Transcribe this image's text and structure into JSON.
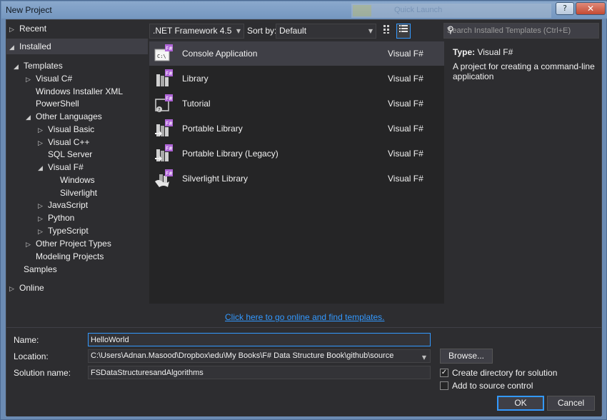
{
  "window": {
    "title": "New Project",
    "background_title": "Quick Launch"
  },
  "titlebar": {
    "help": "?",
    "close": "✕"
  },
  "tree": {
    "recent": "Recent",
    "installed": "Installed",
    "templates": "Templates",
    "visual_csharp": "Visual C#",
    "windows_installer_xml": "Windows Installer XML",
    "powershell": "PowerShell",
    "other_languages": "Other Languages",
    "visual_basic": "Visual Basic",
    "visual_cpp": "Visual C++",
    "sql_server": "SQL Server",
    "visual_fsharp": "Visual F#",
    "windows": "Windows",
    "silverlight": "Silverlight",
    "javascript": "JavaScript",
    "python": "Python",
    "typescript": "TypeScript",
    "other_project_types": "Other Project Types",
    "modeling_projects": "Modeling Projects",
    "samples": "Samples",
    "online": "Online"
  },
  "toolbar": {
    "framework": ".NET Framework 4.5",
    "sort_label": "Sort by:",
    "sort_value": "Default",
    "view_small_icons": "small-icons-view-icon",
    "view_list": "list-view-icon"
  },
  "templates": [
    {
      "name": "Console Application",
      "language": "Visual F#",
      "icon": "console-app-icon"
    },
    {
      "name": "Library",
      "language": "Visual F#",
      "icon": "library-icon"
    },
    {
      "name": "Tutorial",
      "language": "Visual F#",
      "icon": "tutorial-icon"
    },
    {
      "name": "Portable Library",
      "language": "Visual F#",
      "icon": "portable-library-icon"
    },
    {
      "name": "Portable Library (Legacy)",
      "language": "Visual F#",
      "icon": "portable-library-legacy-icon"
    },
    {
      "name": "Silverlight Library",
      "language": "Visual F#",
      "icon": "silverlight-library-icon"
    }
  ],
  "search": {
    "placeholder": "Search Installed Templates (Ctrl+E)"
  },
  "details": {
    "type_label": "Type:",
    "type_value": "Visual F#",
    "description": "A project for creating a command-line application"
  },
  "online_link": "Click here to go online and find templates.",
  "form": {
    "name_label": "Name:",
    "name_value": "HelloWorld",
    "location_label": "Location:",
    "location_value": "C:\\Users\\Adnan.Masood\\Dropbox\\edu\\My Books\\F# Data Structure Book\\github\\source",
    "solution_label": "Solution name:",
    "solution_value": "FSDataStructuresandAlgorithms",
    "browse": "Browse...",
    "create_dir": "Create directory for solution",
    "create_dir_checked": true,
    "source_control": "Add to source control",
    "source_control_checked": false,
    "ok": "OK",
    "cancel": "Cancel"
  },
  "colors": {
    "accent": "#3399ff",
    "fsharp": "#b166d9",
    "dark_bg": "#2d2d30"
  }
}
